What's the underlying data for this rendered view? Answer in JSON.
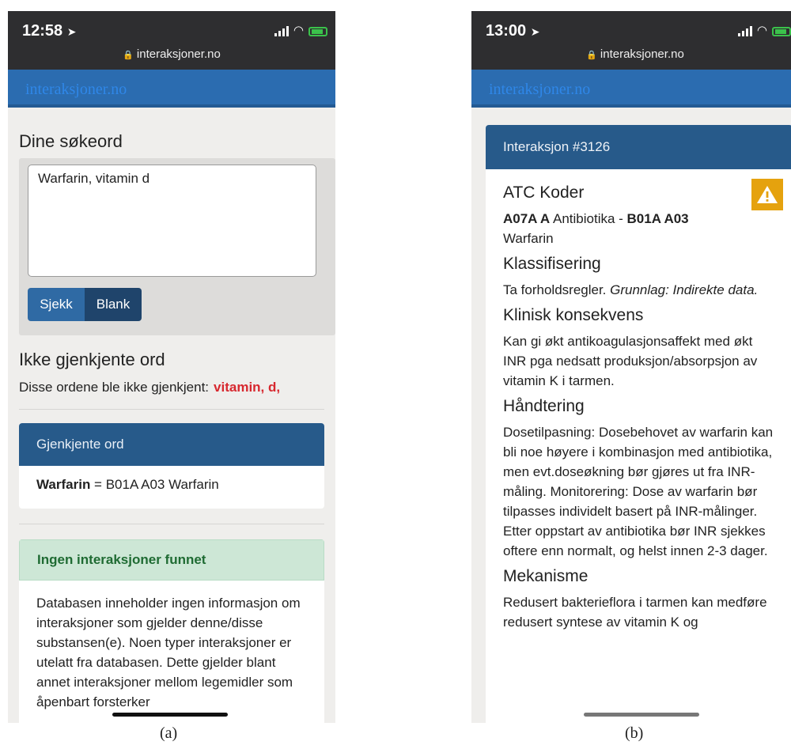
{
  "brand_text": "interaksjoner.no",
  "screen_a": {
    "time": "12:58",
    "url": "interaksjoner.no",
    "search_heading": "Dine søkeord",
    "search_value": "Warfarin, vitamin d",
    "check_button": "Sjekk",
    "blank_button": "Blank",
    "unrecognized_heading": "Ikke gjenkjente ord",
    "unrecognized_text": "Disse ordene ble ikke gjenkjent:",
    "unrecognized_words": "vitamin, d,",
    "recognized_header": "Gjenkjente ord",
    "recognized_drug": "Warfarin",
    "recognized_detail": " = B01A A03 Warfarin",
    "no_interaction_header": "Ingen interaksjoner funnet",
    "no_interaction_text": "Databasen inneholder ingen informasjon om interaksjoner som gjelder denne/disse substansen(e). Noen typer interaksjoner er utelatt fra databasen. Dette gjelder blant annet interaksjoner mellom legemidler som åpenbart forsterker",
    "caption": "(a)"
  },
  "screen_b": {
    "time": "13:00",
    "url": "interaksjoner.no",
    "interaction_header": "Interaksjon #3126",
    "atc_title": "ATC Koder",
    "atc_code1": "A07A A",
    "atc_name1": " Antibiotika - ",
    "atc_code2": "B01A A03",
    "atc_name2": "Warfarin",
    "class_title": "Klassifisering",
    "class_text": "Ta forholdsregler.",
    "class_basis": "Grunnlag: Indirekte data.",
    "consequence_title": "Klinisk konsekvens",
    "consequence_text": "Kan gi økt antikoagulasjonsaffekt med økt INR pga nedsatt produksjon/absorpsjon av vitamin K i tarmen.",
    "handling_title": "Håndtering",
    "handling_text": "Dosetilpasning: Dosebehovet av warfarin kan bli noe høyere i kombinasjon med antibiotika, men evt.doseøkning bør gjøres ut fra INR-måling. Monitorering: Dose av warfarin bør tilpasses individelt basert på INR-målinger. Etter oppstart av antibiotika bør INR sjekkes oftere enn normalt, og helst innen 2-3 dager.",
    "mechanism_title": "Mekanisme",
    "mechanism_text": "Redusert bakterieflora i tarmen kan medføre redusert syntese av vitamin K og",
    "caption": "(b)"
  },
  "colors": {
    "nav_blue": "#2b6cb0",
    "card_header_blue": "#275a8a",
    "warning_orange": "#e5a20e",
    "alert_red": "#d7282f",
    "success_green": "#cde7d6"
  },
  "icons": [
    "location-arrow-icon",
    "signal-icon",
    "wifi-icon",
    "battery-icon",
    "lock-icon",
    "warning-icon"
  ]
}
